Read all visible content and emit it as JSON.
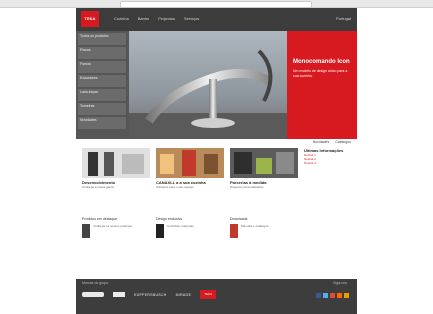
{
  "header": {
    "logo_text": "TEKA",
    "nav": [
      "Cozinha",
      "Banho",
      "Projectos",
      "Serviços"
    ],
    "lang_label": "Portugal"
  },
  "sidebar": {
    "items": [
      {
        "label": "Todos os produtos"
      },
      {
        "label": "Placas"
      },
      {
        "label": "Fornos"
      },
      {
        "label": "Exaustores"
      },
      {
        "label": "Lava-loiças"
      },
      {
        "label": "Torneiras"
      },
      {
        "label": "Novidades"
      }
    ]
  },
  "hero": {
    "title": "Monocomando Icon",
    "description": "Um modelo de design único para a sua cozinha."
  },
  "tabs": [
    "Novidades",
    "Catálogos"
  ],
  "cards": [
    {
      "title": "Desenvolvimento",
      "desc": "Conheça a nossa gama"
    },
    {
      "title": "CANAXLL a a sua cozinha",
      "desc": "Soluções para o seu espaço"
    },
    {
      "title": "Parcerias à medida",
      "desc": "Projectos personalizados"
    }
  ],
  "news": {
    "heading": "Últimas Informações",
    "items": [
      "Notícia 1",
      "Notícia 2",
      "Notícia 3"
    ]
  },
  "sub_sections": [
    {
      "heading": "Produtos em destaque",
      "text": "Conheça os nossos produtos"
    },
    {
      "heading": "Design exclusivo",
      "text": "Cozinhas modernas"
    },
    {
      "heading": "Downloads",
      "text": "Manuais e catálogos"
    }
  ],
  "footer": {
    "partners_heading": "Marcas do grupo",
    "partners": [
      "RECORD",
      "KÜPPERSBUSCH",
      "MIRAGE",
      "TEKA"
    ],
    "social_heading": "Siga-nos",
    "social_colors": [
      "#3b5998",
      "#55acee",
      "#dd4b39",
      "#ff6600",
      "#e3a000"
    ]
  }
}
